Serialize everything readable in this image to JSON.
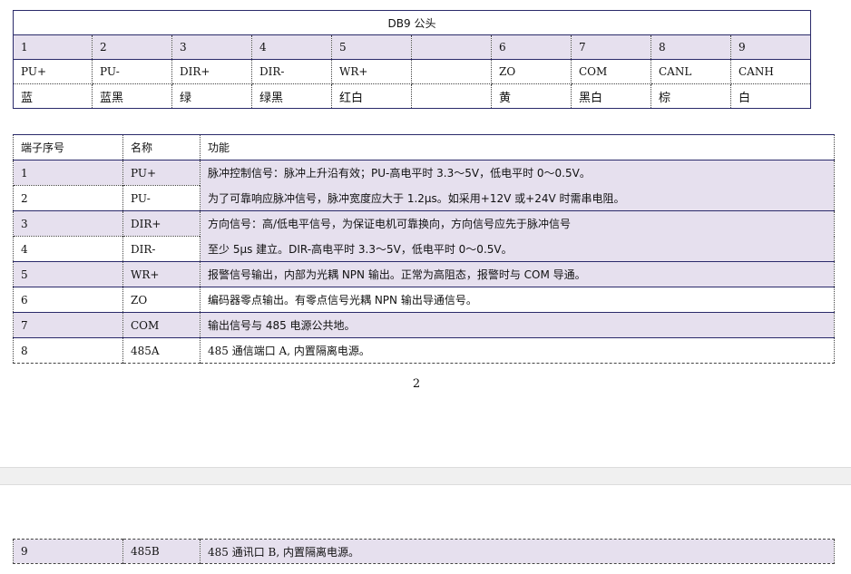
{
  "db9_table": {
    "title": "DB9 公头",
    "pin_numbers": [
      "1",
      "2",
      "3",
      "4",
      "5",
      "",
      "6",
      "7",
      "8",
      "9"
    ],
    "signals": [
      "PU+",
      "PU-",
      "DIR+",
      "DIR-",
      "WR+",
      "",
      "ZO",
      "COM",
      "CANL",
      "CANH"
    ],
    "colors": [
      "蓝",
      "蓝黑",
      "绿",
      "绿黑",
      "红白",
      "",
      "黄",
      "黑白",
      "棕",
      "白"
    ]
  },
  "pin_table": {
    "headers": [
      "端子序号",
      "名称",
      "功能"
    ],
    "rows": [
      {
        "num": "1",
        "name": "PU+"
      },
      {
        "num": "2",
        "name": "PU-"
      },
      {
        "num": "3",
        "name": "DIR+"
      },
      {
        "num": "4",
        "name": "DIR-"
      },
      {
        "num": "5",
        "name": "WR+",
        "func": "报警信号输出，内部为光耦 NPN 输出。正常为高阻态，报警时与 COM 导通。"
      },
      {
        "num": "6",
        "name": "ZO",
        "func": "编码器零点输出。有零点信号光耦 NPN 输出导通信号。"
      },
      {
        "num": "7",
        "name": "COM",
        "func": "输出信号与 485 电源公共地。"
      },
      {
        "num": "8",
        "name": "485A",
        "func": "485 通信端口 A,  内置隔离电源。"
      }
    ],
    "pulse_func_line1": "脉冲控制信号：脉冲上升沿有效；PU-高电平时 3.3～5V，低电平时  0～0.5V。",
    "pulse_func_line2": "为了可靠响应脉冲信号，脉冲宽度应大于  1.2μs。如采用+12V 或+24V 时需串电阻。",
    "dir_func_line1": "方向信号：高/低电平信号，为保证电机可靠换向，方向信号应先于脉冲信号",
    "dir_func_line2": "至少  5μs  建立。DIR-高电平时 3.3～5V，低电平时 0～0.5V。"
  },
  "page_number": "2",
  "next_page_table": {
    "rows": [
      {
        "num": "9",
        "name": "485B",
        "func": "485 通讯口 B,  内置隔离电源。"
      }
    ]
  }
}
